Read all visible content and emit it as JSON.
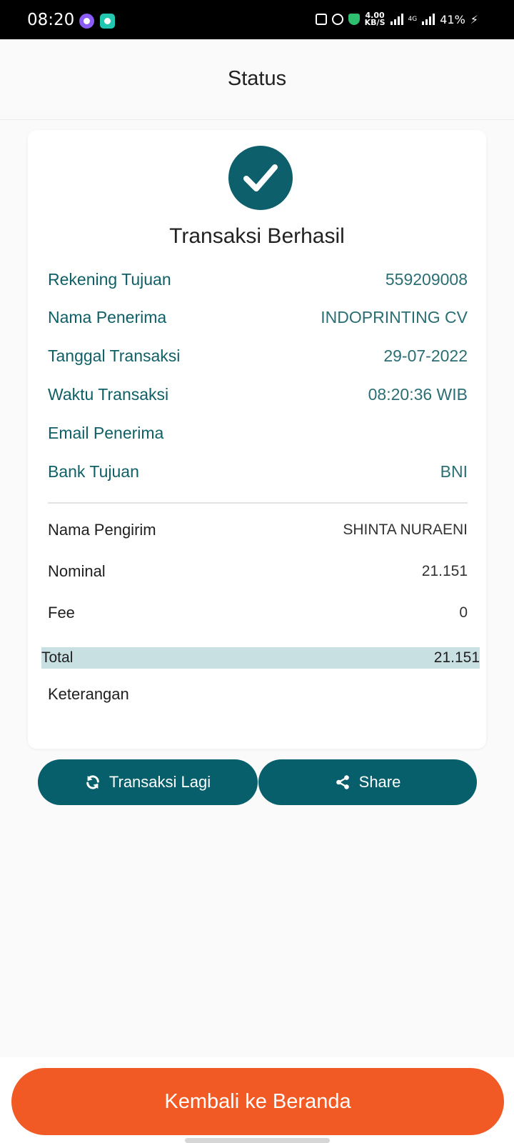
{
  "status_bar": {
    "time": "08:20",
    "speed_value": "4.00",
    "speed_unit": "KB/S",
    "network": "4G",
    "battery": "41%"
  },
  "header": {
    "title": "Status"
  },
  "result": {
    "title": "Transaksi Berhasil",
    "rows": [
      {
        "label": "Rekening Tujuan",
        "value": "559209008"
      },
      {
        "label": "Nama Penerima",
        "value": "INDOPRINTING CV"
      },
      {
        "label": "Tanggal Transaksi",
        "value": "29-07-2022"
      },
      {
        "label": "Waktu Transaksi",
        "value": "08:20:36 WIB"
      },
      {
        "label": "Email Penerima",
        "value": ""
      },
      {
        "label": "Bank Tujuan",
        "value": "BNI"
      }
    ],
    "sender": [
      {
        "label": "Nama Pengirim",
        "value": "SHINTA NURAENI"
      },
      {
        "label": "Nominal",
        "value": "21.151"
      },
      {
        "label": "Fee",
        "value": "0"
      }
    ],
    "total": {
      "label": "Total",
      "value": "21.151"
    },
    "note": {
      "label": "Keterangan",
      "value": ""
    }
  },
  "actions": {
    "again_label": "Transaksi Lagi",
    "share_label": "Share"
  },
  "footer": {
    "home_label": "Kembali ke Beranda"
  },
  "colors": {
    "teal": "#065f6b",
    "orange": "#f15a24",
    "total_bg": "#c9e0e2"
  },
  "icons": {
    "success": "check-circle-icon",
    "again": "refresh-icon",
    "share": "share-icon"
  }
}
